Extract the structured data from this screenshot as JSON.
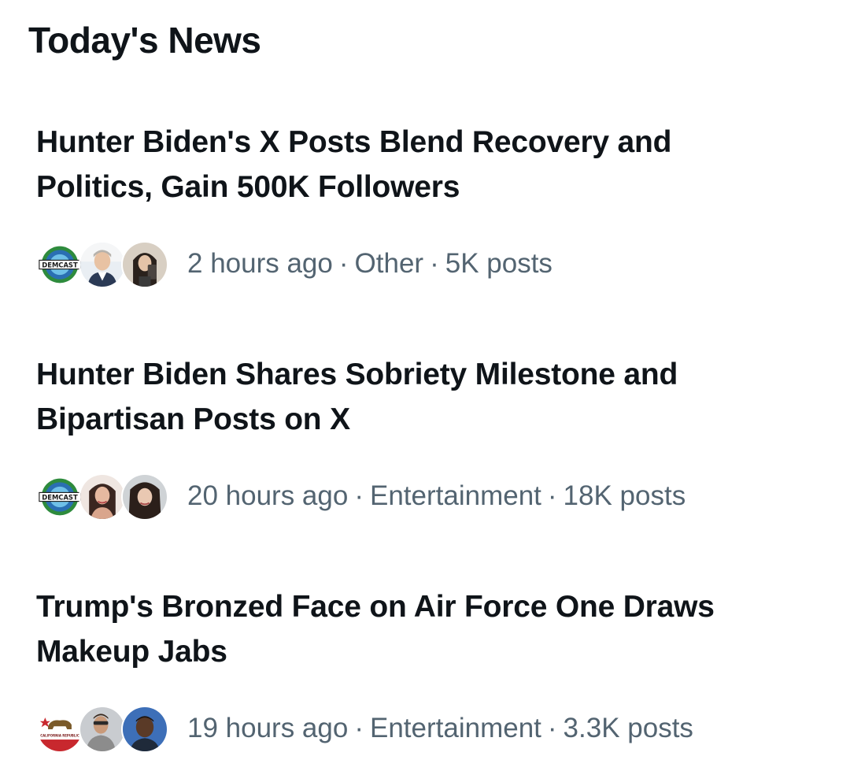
{
  "section": {
    "title": "Today's News"
  },
  "news": [
    {
      "headline_line1": "Hunter Biden's X Posts Blend Recovery and",
      "headline_line2": "Politics, Gain 500K Followers",
      "time": "2 hours ago",
      "category": "Other",
      "posts": "5K posts",
      "avatars": [
        {
          "icon": "demcast-logo-avatar",
          "logo_text": "DEMCAST"
        },
        {
          "icon": "man-portrait-avatar"
        },
        {
          "icon": "woman-selfie-avatar"
        }
      ]
    },
    {
      "headline_line1": "Hunter Biden Shares Sobriety Milestone and",
      "headline_line2": "Bipartisan Posts on X",
      "time": "20 hours ago",
      "category": "Entertainment",
      "posts": "18K posts",
      "avatars": [
        {
          "icon": "demcast-logo-avatar",
          "logo_text": "DEMCAST"
        },
        {
          "icon": "woman-portrait-avatar"
        },
        {
          "icon": "woman-selfie-avatar"
        }
      ]
    },
    {
      "headline_line1": "Trump's Bronzed Face on Air Force One Draws",
      "headline_line2": "Makeup Jabs",
      "time": "19 hours ago",
      "category": "Entertainment",
      "posts": "3.3K posts",
      "avatars": [
        {
          "icon": "california-flag-avatar",
          "logo_text": "CALIFORNIA REPUBLIC"
        },
        {
          "icon": "man-portrait-avatar"
        },
        {
          "icon": "man-portrait-avatar"
        }
      ]
    }
  ],
  "colors": {
    "text_primary": "#0f1419",
    "text_secondary": "#536471",
    "background": "#ffffff",
    "demcast_green": "#2e8b3d",
    "demcast_blue": "#2a6fb3",
    "california_red": "#c8282e",
    "california_bear": "#7a5a2a"
  }
}
